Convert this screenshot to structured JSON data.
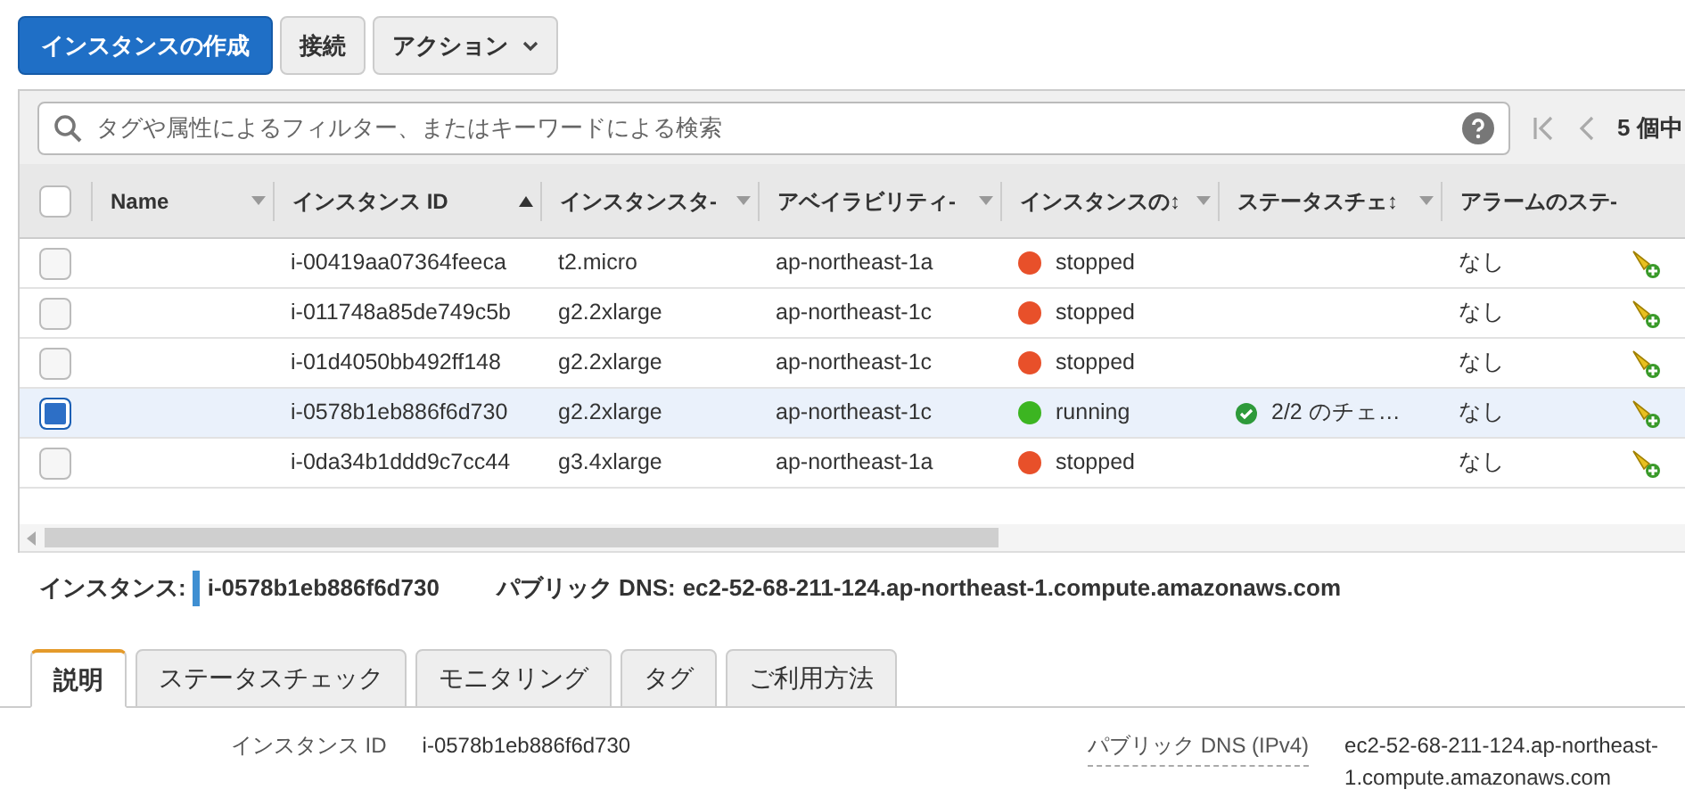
{
  "toolbar": {
    "buttons": [
      {
        "label": "インスタンスの作成",
        "kind": "primary"
      },
      {
        "label": "接続",
        "kind": "plain"
      },
      {
        "label": "アクション",
        "kind": "dropdown"
      }
    ]
  },
  "search": {
    "placeholder": "タグや属性によるフィルター、またはキーワードによる検索"
  },
  "pagination": {
    "text": "5 個中"
  },
  "table": {
    "select_all": {
      "checked": false
    },
    "columns": [
      {
        "label": "Name",
        "kind": "menu"
      },
      {
        "label": "インスタンス ID",
        "kind": "sorted"
      },
      {
        "label": "インスタンスタ-",
        "kind": "menu"
      },
      {
        "label": "アベイラビリティ-",
        "kind": "menu"
      },
      {
        "label": "インスタンスの↕",
        "kind": "menu"
      },
      {
        "label": "ステータスチェ↕",
        "kind": "menu"
      },
      {
        "label": "アラームのステ-",
        "kind": "plain"
      }
    ],
    "rows": [
      {
        "selected": false,
        "id": "i-00419aa07364feeca",
        "type": "t2.micro",
        "zone": "ap-northeast-1a",
        "state": "stopped",
        "color": "#e8502a",
        "alarm": "なし"
      },
      {
        "selected": false,
        "id": "i-011748a85de749c5b",
        "type": "g2.2xlarge",
        "zone": "ap-northeast-1c",
        "state": "stopped",
        "color": "#e8502a",
        "alarm": "なし"
      },
      {
        "selected": false,
        "id": "i-01d4050bb492ff148",
        "type": "g2.2xlarge",
        "zone": "ap-northeast-1c",
        "state": "stopped",
        "color": "#e8502a",
        "alarm": "なし"
      },
      {
        "selected": true,
        "id": "i-0578b1eb886f6d730",
        "type": "g2.2xlarge",
        "zone": "ap-northeast-1c",
        "state": "running",
        "color": "#3cb521",
        "status_check": "2/2 のチェ…",
        "alarm": "なし"
      },
      {
        "selected": false,
        "id": "i-0da34b1ddd9c7cc44",
        "type": "g3.4xlarge",
        "zone": "ap-northeast-1a",
        "state": "stopped",
        "color": "#e8502a",
        "alarm": "なし"
      }
    ]
  },
  "detail": {
    "instance_label": "インスタンス:",
    "instance_id": "i-0578b1eb886f6d730",
    "dns_label": "パブリック DNS:",
    "dns": "ec2-52-68-211-124.ap-northeast-1.compute.amazonaws.com",
    "tabs": [
      {
        "label": "説明",
        "selected": true
      },
      {
        "label": "ステータスチェック",
        "selected": false
      },
      {
        "label": "モニタリング",
        "selected": false
      },
      {
        "label": "タグ",
        "selected": false
      },
      {
        "label": "ご利用方法",
        "selected": false
      }
    ],
    "fields": [
      {
        "label": "インスタンス ID",
        "value": "i-0578b1eb886f6d730"
      },
      {
        "label": "パブリック DNS (IPv4)",
        "value": "ec2-52-68-211-124.ap-northeast-1.compute.amazonaws.com"
      }
    ]
  }
}
